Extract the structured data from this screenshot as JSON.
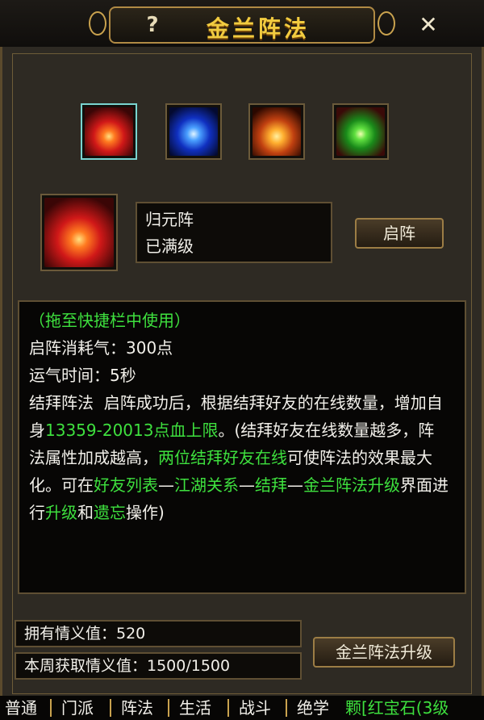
{
  "window": {
    "title": "金兰阵法",
    "help_label": "?",
    "close_label": "✕"
  },
  "formations": [
    {
      "icon": "gui-yuan-formation-icon",
      "selected": true
    },
    {
      "icon": "blue-star-formation-icon",
      "selected": false
    },
    {
      "icon": "orange-sun-formation-icon",
      "selected": false
    },
    {
      "icon": "green-triangle-formation-icon",
      "selected": false
    }
  ],
  "selected": {
    "name": "归元阵",
    "status": "已满级",
    "activate_label": "启阵"
  },
  "description": {
    "hint": "（拖至快捷栏中使用）",
    "cost": "启阵消耗气：300点",
    "duration": "运气时间：5秒",
    "p1": "结拜阵法  启阵成功后，根据结拜好友的在线数量，增加自身",
    "hp_range": "13359-20013点血上限",
    "p2": "。(结拜好友在线数量越多，阵法属性加成越高，",
    "two_friends": "两位结拜好友在线",
    "p3": "可使阵法的效果最大化。可在",
    "friend_list": "好友列表",
    "dash1": "—",
    "jianghu": "江湖关系",
    "dash2": "—",
    "jiebai": "结拜",
    "dash3": "—",
    "upgrade_ui": "金兰阵法升级",
    "p4": "界面进行",
    "upgrade": "升级",
    "and": "和",
    "forget": "遗忘",
    "p5": "操作)"
  },
  "stats": {
    "owned_label": "拥有情义值：520",
    "weekly_label": "本周获取情义值：1500/1500"
  },
  "upgrade_button": "金兰阵法升级",
  "chat_tabs": [
    "普通",
    "门派",
    "阵法",
    "生活",
    "战斗",
    "绝学"
  ],
  "chat_overflow": "颗[红宝石(3级",
  "colors": {
    "title": "#f2cc40",
    "highlight_green": "#3ee03e",
    "border_gold": "#9c7d45"
  }
}
